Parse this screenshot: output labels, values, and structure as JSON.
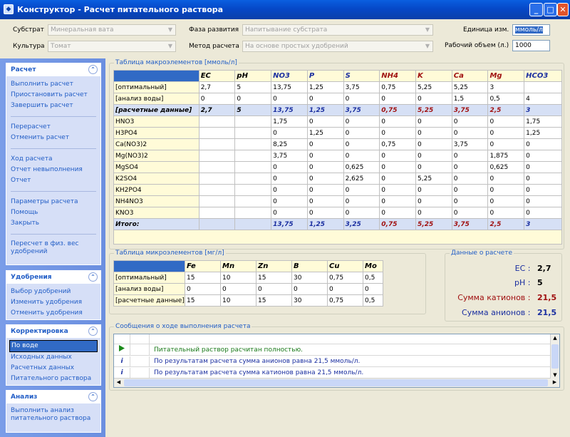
{
  "window": {
    "title": "Конструктор - Расчет питательного раствора",
    "app_icon": "app-icon"
  },
  "top": {
    "substrate_label": "Субстрат",
    "substrate_value": "Минеральная вата",
    "culture_label": "Культура",
    "culture_value": "Томат",
    "phase_label": "Фаза развития",
    "phase_value": "Напитывание субстрата",
    "method_label": "Метод расчета",
    "method_value": "На основе простых удобрений",
    "unit_label": "Единица изм.",
    "unit_value": "ммоль/л",
    "volume_label": "Рабочий объем (л.)",
    "volume_value": "1000"
  },
  "sidebar": {
    "calc": {
      "title": "Расчет",
      "items": [
        "Выполнить расчет",
        "Приостановить расчет",
        "Завершить расчет",
        "Перерасчет",
        "Отменить расчет",
        "Ход расчета",
        "Отчет невыполнения",
        "Отчет",
        "Параметры расчета",
        "Помощь",
        "Закрыть",
        "Пересчет в физ. вес удобрений"
      ]
    },
    "fert": {
      "title": "Удобрения",
      "items": [
        "Выбор удобрений",
        "Изменить удобрения",
        "Отменить удобрения"
      ]
    },
    "corr": {
      "title": "Корректировка",
      "items": [
        "По воде",
        "Исходных данных",
        "Расчетных данных",
        "Питательного раствора"
      ]
    },
    "anal": {
      "title": "Анализ",
      "items": [
        "Выполнить анализ питательного раствора"
      ]
    }
  },
  "macro": {
    "title": "Таблица макроэлементов [ммоль/л]",
    "headers": [
      "EC",
      "pH",
      "NO3",
      "P",
      "S",
      "NH4",
      "K",
      "Ca",
      "Mg",
      "HCO3"
    ],
    "rows": [
      {
        "label": "[оптимальный]",
        "values": [
          "2,7",
          "5",
          "13,75",
          "1,25",
          "3,75",
          "0,75",
          "5,25",
          "5,25",
          "3",
          ""
        ]
      },
      {
        "label": "[анализ воды]",
        "values": [
          "0",
          "0",
          "0",
          "0",
          "0",
          "0",
          "0",
          "1,5",
          "0,5",
          "4"
        ]
      },
      {
        "label": "[расчетные данные]",
        "values": [
          "2,7",
          "5",
          "13,75",
          "1,25",
          "3,75",
          "0,75",
          "5,25",
          "3,75",
          "2,5",
          "3"
        ]
      },
      {
        "label": "HNO3",
        "values": [
          "",
          "",
          "1,75",
          "0",
          "0",
          "0",
          "0",
          "0",
          "0",
          "1,75"
        ]
      },
      {
        "label": "H3PO4",
        "values": [
          "",
          "",
          "0",
          "1,25",
          "0",
          "0",
          "0",
          "0",
          "0",
          "1,25"
        ]
      },
      {
        "label": "Ca(NO3)2",
        "values": [
          "",
          "",
          "8,25",
          "0",
          "0",
          "0,75",
          "0",
          "3,75",
          "0",
          "0"
        ]
      },
      {
        "label": "Mg(NO3)2",
        "values": [
          "",
          "",
          "3,75",
          "0",
          "0",
          "0",
          "0",
          "0",
          "1,875",
          "0"
        ]
      },
      {
        "label": "MgSO4",
        "values": [
          "",
          "",
          "0",
          "0",
          "0,625",
          "0",
          "0",
          "0",
          "0,625",
          "0"
        ]
      },
      {
        "label": "K2SO4",
        "values": [
          "",
          "",
          "0",
          "0",
          "2,625",
          "0",
          "5,25",
          "0",
          "0",
          "0"
        ]
      },
      {
        "label": "KH2PO4",
        "values": [
          "",
          "",
          "0",
          "0",
          "0",
          "0",
          "0",
          "0",
          "0",
          "0"
        ]
      },
      {
        "label": "NH4NO3",
        "values": [
          "",
          "",
          "0",
          "0",
          "0",
          "0",
          "0",
          "0",
          "0",
          "0"
        ]
      },
      {
        "label": "KNO3",
        "values": [
          "",
          "",
          "0",
          "0",
          "0",
          "0",
          "0",
          "0",
          "0",
          "0"
        ]
      },
      {
        "label": "Итого:",
        "values": [
          "",
          "",
          "13,75",
          "1,25",
          "3,25",
          "0,75",
          "5,25",
          "3,75",
          "2,5",
          "3"
        ]
      }
    ]
  },
  "micro": {
    "title": "Таблица микроэлементов [мг/л]",
    "headers": [
      "Fe",
      "Mn",
      "Zn",
      "B",
      "Cu",
      "Mo"
    ],
    "rows": [
      {
        "label": "[оптимальный]",
        "values": [
          "15",
          "10",
          "15",
          "30",
          "0,75",
          "0,5"
        ]
      },
      {
        "label": "[анализ воды]",
        "values": [
          "0",
          "0",
          "0",
          "0",
          "0",
          "0"
        ]
      },
      {
        "label": "[расчетные данные]",
        "values": [
          "15",
          "10",
          "15",
          "30",
          "0,75",
          "0,5"
        ]
      }
    ]
  },
  "info": {
    "title": "Данные о расчете",
    "ec_label": "EC :",
    "ec_value": "2,7",
    "ph_label": "pH :",
    "ph_value": "5",
    "cat_label": "Сумма катионов :",
    "cat_value": "21,5",
    "an_label": "Сумма анионов :",
    "an_value": "21,5"
  },
  "messages": {
    "title": "Сообщения о ходе выполнения расчета",
    "rows": [
      {
        "icon": "play-icon",
        "text": "Питательный раствор расчитан полностью."
      },
      {
        "icon": "info-icon",
        "text": "По результатам расчета сумма анионов равна 21,5 ммоль/л."
      },
      {
        "icon": "info-icon",
        "text": "По результатам расчета сумма катионов равна 21,5 ммоль/л."
      }
    ]
  },
  "colors": {
    "accent": "#215dc6",
    "red": "#a01010",
    "blue": "#1b2fa0",
    "green": "#1a7a1a"
  }
}
